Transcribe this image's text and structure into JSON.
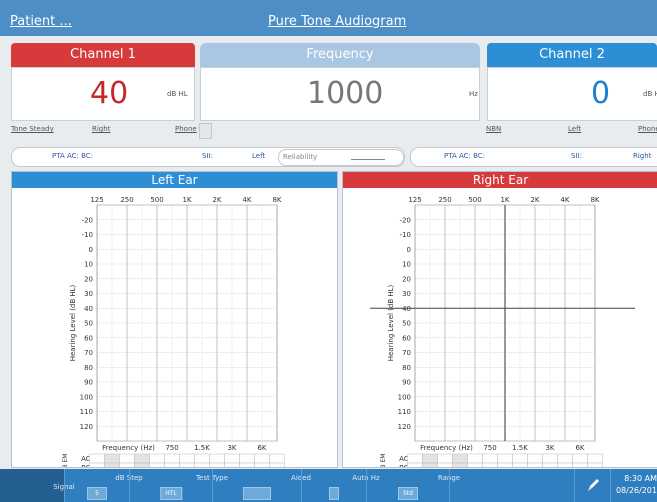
{
  "header": {
    "patient": "Patient ...",
    "title": "Pure Tone Audiogram"
  },
  "channel1": {
    "label": "Channel 1",
    "value": "40",
    "unit": "dB HL",
    "tone": "Tone Steady",
    "ear": "Right",
    "transducer": "Phone"
  },
  "frequency": {
    "label": "Frequency",
    "value": "1000",
    "unit": "Hz"
  },
  "channel2": {
    "label": "Channel 2",
    "value": "0",
    "unit": "dB HL",
    "masking": "NBN",
    "ear": "Left",
    "transducer": "Phone"
  },
  "left_info": {
    "pta": "PTA AC: BC:",
    "sii": "SII:",
    "ear": "Left",
    "reliability_placeholder": "Reliability"
  },
  "right_info": {
    "pta": "PTA AC: BC:",
    "sii": "SII:",
    "ear": "Right"
  },
  "left_ear": {
    "title": "Left Ear"
  },
  "right_ear": {
    "title": "Right Ear"
  },
  "chart": {
    "freq_top": [
      "125",
      "250",
      "500",
      "1K",
      "2K",
      "4K",
      "8K"
    ],
    "freq_bottom": [
      "750",
      "1.5K",
      "3K",
      "6K"
    ],
    "freq_label": "Frequency (Hz)",
    "db_levels": [
      "-20",
      "-10",
      "0",
      "10",
      "20",
      "30",
      "40",
      "50",
      "60",
      "70",
      "80",
      "90",
      "100",
      "110",
      "120"
    ],
    "ylabel": "Hearing Level (dB HL)",
    "em_label": "dB EM",
    "ac": "AC:",
    "bc": "BC:"
  },
  "cursor": {
    "freq": "1K",
    "db": 40
  },
  "bottom": {
    "signal": "Signal",
    "db_step": {
      "label": "dB Step",
      "value": "5"
    },
    "test_type": {
      "label": "Test Type",
      "value": "HTL"
    },
    "aided": {
      "label": "Aided",
      "value": ""
    },
    "auto_hz": {
      "label": "Auto Hz",
      "value": ""
    },
    "range": {
      "label": "Range",
      "value": "Std"
    },
    "time": "8:30 AM",
    "date": "08/26/201"
  }
}
